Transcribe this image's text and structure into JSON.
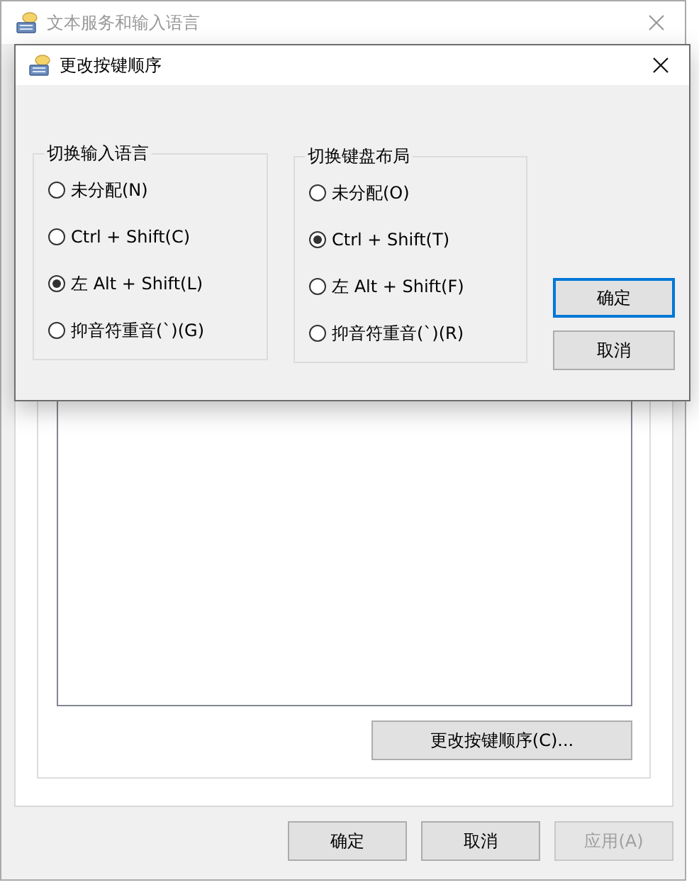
{
  "background_window": {
    "title": "文本服务和输入语言",
    "change_key_sequence_button": "更改按键顺序(C)...",
    "buttons": [
      {
        "label": "确定",
        "disabled": false
      },
      {
        "label": "取消",
        "disabled": false
      },
      {
        "label": "应用(A)",
        "disabled": true
      }
    ]
  },
  "dialog": {
    "title": "更改按键顺序",
    "groups": [
      {
        "title": "切换输入语言",
        "options": [
          {
            "label": "未分配(N)",
            "selected": false
          },
          {
            "label": "Ctrl + Shift(C)",
            "selected": false
          },
          {
            "label": "左 Alt + Shift(L)",
            "selected": true
          },
          {
            "label": "抑音符重音(`)(G)",
            "selected": false
          }
        ]
      },
      {
        "title": "切换键盘布局",
        "options": [
          {
            "label": "未分配(O)",
            "selected": false
          },
          {
            "label": "Ctrl + Shift(T)",
            "selected": true
          },
          {
            "label": "左 Alt + Shift(F)",
            "selected": false
          },
          {
            "label": "抑音符重音(`)(R)",
            "selected": false
          }
        ]
      }
    ],
    "buttons": [
      {
        "label": "确定",
        "default": true
      },
      {
        "label": "取消",
        "default": false
      }
    ]
  }
}
